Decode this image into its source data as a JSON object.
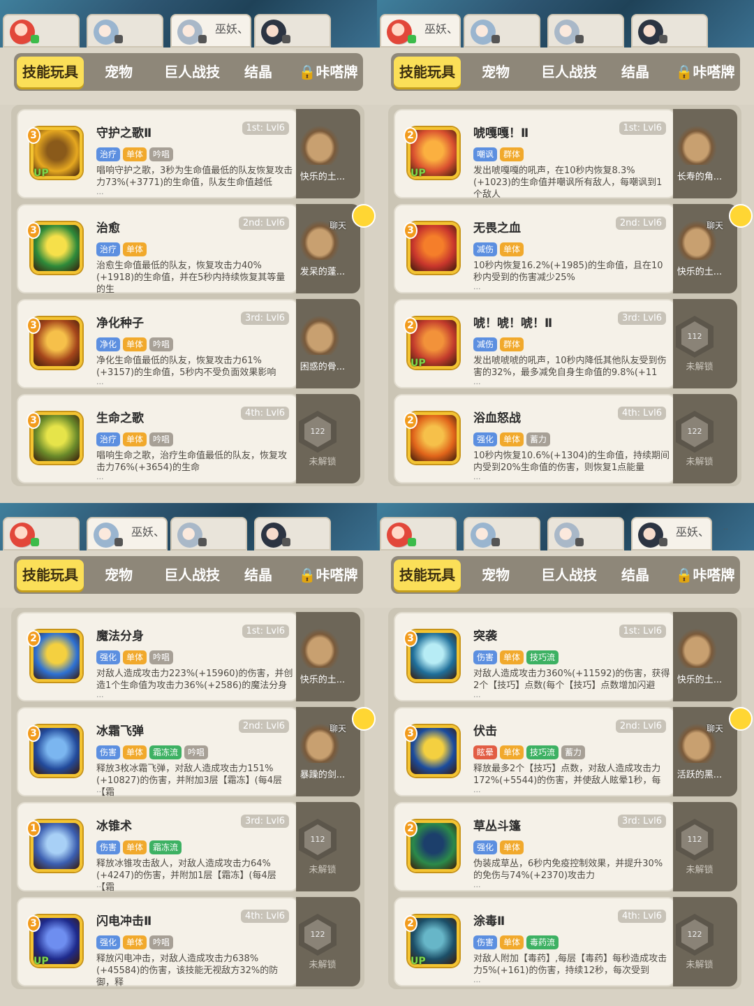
{
  "top_tabs": [
    "技能玩具",
    "宠物",
    "巨人战技",
    "结晶",
    "🔒咔嗒牌"
  ],
  "player_name": "巫妖、",
  "player_name_suffix": "..",
  "quads": [
    {
      "active_player": 0,
      "skills": [
        {
          "lv": "2",
          "name": "唬嘎嘎！Ⅱ",
          "rank": "1st: Lvl6",
          "tags": [
            [
              "嘲讽",
              "blue"
            ],
            [
              "群体",
              "orange"
            ]
          ],
          "desc": "发出唬嘎嘎的吼声，在10秒内恢复8.3%(+1023)的生命值并嘲讽所有敌人，每嘲讽到1个敌人",
          "up": true
        },
        {
          "lv": "3",
          "name": "无畏之血",
          "rank": "2nd: Lvl6",
          "tags": [
            [
              "减伤",
              "blue"
            ],
            [
              "单体",
              "orange"
            ]
          ],
          "desc": "10秒内恢复16.2%(+1985)的生命值，且在10秒内受到的伤害减少25%",
          "up": false
        },
        {
          "lv": "2",
          "name": "唬！唬！唬！Ⅱ",
          "rank": "3rd: Lvl6",
          "tags": [
            [
              "减伤",
              "blue"
            ],
            [
              "群体",
              "orange"
            ]
          ],
          "desc": "发出唬唬唬的吼声，10秒内降低其他队友受到伤害的32%，最多减免自身生命值的9.8%(+11",
          "up": true
        },
        {
          "lv": "2",
          "name": "浴血怒战",
          "rank": "4th: Lvl6",
          "tags": [
            [
              "强化",
              "blue"
            ],
            [
              "单体",
              "orange"
            ],
            [
              "蓄力",
              "gray"
            ]
          ],
          "desc": "10秒内恢复10.6%(+1304)的生命值，持续期间内受到20%生命值的伤害，则恢复1点能量",
          "up": false
        }
      ],
      "side": [
        [
          "pet",
          "长寿的角..."
        ],
        [
          "pet",
          "快乐的土..."
        ],
        [
          "lock",
          "112",
          "未解锁"
        ],
        [
          "lock",
          "122",
          "未解锁"
        ]
      ]
    },
    {
      "active_player": 1,
      "skills": [
        {
          "lv": "2",
          "name": "魔法分身",
          "rank": "1st: Lvl6",
          "tags": [
            [
              "强化",
              "blue"
            ],
            [
              "单体",
              "orange"
            ],
            [
              "吟唱",
              "gray"
            ]
          ],
          "desc": "对敌人造成攻击力223%(+15960)的伤害，并创造1个生命值为攻击力36%(+2586)的魔法分身",
          "up": false
        },
        {
          "lv": "3",
          "name": "冰霜飞弹",
          "rank": "2nd: Lvl6",
          "tags": [
            [
              "伤害",
              "blue"
            ],
            [
              "单体",
              "orange"
            ],
            [
              "霜冻流",
              "green"
            ],
            [
              "吟唱",
              "gray"
            ]
          ],
          "desc": "释放3枚冰霜飞弹，对敌人造成攻击力151%(+10827)的伤害，并附加3层【霜冻】(每4层【霜",
          "up": false
        },
        {
          "lv": "1",
          "name": "冰锥术",
          "rank": "3rd: Lvl6",
          "tags": [
            [
              "伤害",
              "blue"
            ],
            [
              "单体",
              "orange"
            ],
            [
              "霜冻流",
              "green"
            ]
          ],
          "desc": "释放冰锥攻击敌人，对敌人造成攻击力64%(+4247)的伤害，并附加1层【霜冻】(每4层【霜",
          "up": false
        },
        {
          "lv": "3",
          "name": "闪电冲击Ⅱ",
          "rank": "4th: Lvl6",
          "tags": [
            [
              "强化",
              "blue"
            ],
            [
              "单体",
              "orange"
            ],
            [
              "吟唱",
              "gray"
            ]
          ],
          "desc": "释放闪电冲击，对敌人造成攻击力638%(+45584)的伤害，该技能无视敌方32%的防御，释",
          "up": true
        }
      ],
      "side": [
        [
          "pet",
          "快乐的土..."
        ],
        [
          "pet",
          "暴躁的剑..."
        ],
        [
          "lock",
          "112",
          "未解锁"
        ],
        [
          "lock",
          "122",
          "未解锁"
        ]
      ]
    },
    {
      "active_player": 3,
      "skills": [
        {
          "lv": "3",
          "name": "突袭",
          "rank": "1st: Lvl6",
          "tags": [
            [
              "伤害",
              "blue"
            ],
            [
              "单体",
              "orange"
            ],
            [
              "技巧流",
              "green"
            ]
          ],
          "desc": "对敌人造成攻击力360%(+11592)的伤害，获得2个【技巧】点数(每个【技巧】点数增加闪避",
          "up": false
        },
        {
          "lv": "3",
          "name": "伏击",
          "rank": "2nd: Lvl6",
          "tags": [
            [
              "眩晕",
              "red"
            ],
            [
              "单体",
              "orange"
            ],
            [
              "技巧流",
              "green"
            ],
            [
              "蓄力",
              "gray"
            ]
          ],
          "desc": "释放最多2个【技巧】点数，对敌人造成攻击力172%(+5544)的伤害，并使敌人眩晕1秒，每",
          "up": false
        },
        {
          "lv": "2",
          "name": "草丛斗篷",
          "rank": "3rd: Lvl6",
          "tags": [
            [
              "强化",
              "blue"
            ],
            [
              "单体",
              "orange"
            ]
          ],
          "desc": "伪装成草丛，6秒内免疫控制效果，并提升30%的免伤与74%(+2370)攻击力",
          "up": false
        },
        {
          "lv": "2",
          "name": "涂毒Ⅱ",
          "rank": "4th: Lvl6",
          "tags": [
            [
              "伤害",
              "blue"
            ],
            [
              "单体",
              "orange"
            ],
            [
              "毒药流",
              "green"
            ]
          ],
          "desc": "对敌人附加【毒药】,每层【毒药】每秒造成攻击力5%(+161)的伤害，持续12秒，每次受到",
          "up": true
        }
      ],
      "side": [
        [
          "pet",
          "快乐的土..."
        ],
        [
          "pet",
          "活跃的黑..."
        ],
        [
          "lock",
          "112",
          "未解锁"
        ],
        [
          "lock",
          "122",
          "未解锁"
        ]
      ]
    },
    {
      "active_player": 2,
      "skills": [
        {
          "lv": "3",
          "name": "守护之歌Ⅱ",
          "rank": "1st: Lvl6",
          "tags": [
            [
              "治疗",
              "blue"
            ],
            [
              "单体",
              "orange"
            ],
            [
              "吟唱",
              "gray"
            ]
          ],
          "desc": "唱响守护之歌，3秒为生命值最低的队友恢复攻击力73%(+3771)的生命值，队友生命值越低",
          "up": true
        },
        {
          "lv": "3",
          "name": "治愈",
          "rank": "2nd: Lvl6",
          "tags": [
            [
              "治疗",
              "blue"
            ],
            [
              "单体",
              "orange"
            ]
          ],
          "desc": "治愈生命值最低的队友，恢复攻击力40%(+1918)的生命值，并在5秒内持续恢复其等量的生",
          "up": false
        },
        {
          "lv": "3",
          "name": "净化种子",
          "rank": "3rd: Lvl6",
          "tags": [
            [
              "净化",
              "blue"
            ],
            [
              "单体",
              "orange"
            ],
            [
              "吟唱",
              "gray"
            ]
          ],
          "desc": "净化生命值最低的队友，恢复攻击力61%(+3157)的生命值，5秒内不受负面效果影响",
          "up": false
        },
        {
          "lv": "3",
          "name": "生命之歌",
          "rank": "4th: Lvl6",
          "tags": [
            [
              "治疗",
              "blue"
            ],
            [
              "单体",
              "orange"
            ],
            [
              "吟唱",
              "gray"
            ]
          ],
          "desc": "唱响生命之歌，治疗生命值最低的队友，恢复攻击力76%(+3654)的生命",
          "up": false
        }
      ],
      "side": [
        [
          "pet",
          "快乐的土..."
        ],
        [
          "pet",
          "发呆的蓬..."
        ],
        [
          "pet",
          "困惑的骨..."
        ],
        [
          "lock",
          "122",
          "未解锁"
        ]
      ]
    }
  ],
  "chat_label": "聊天"
}
